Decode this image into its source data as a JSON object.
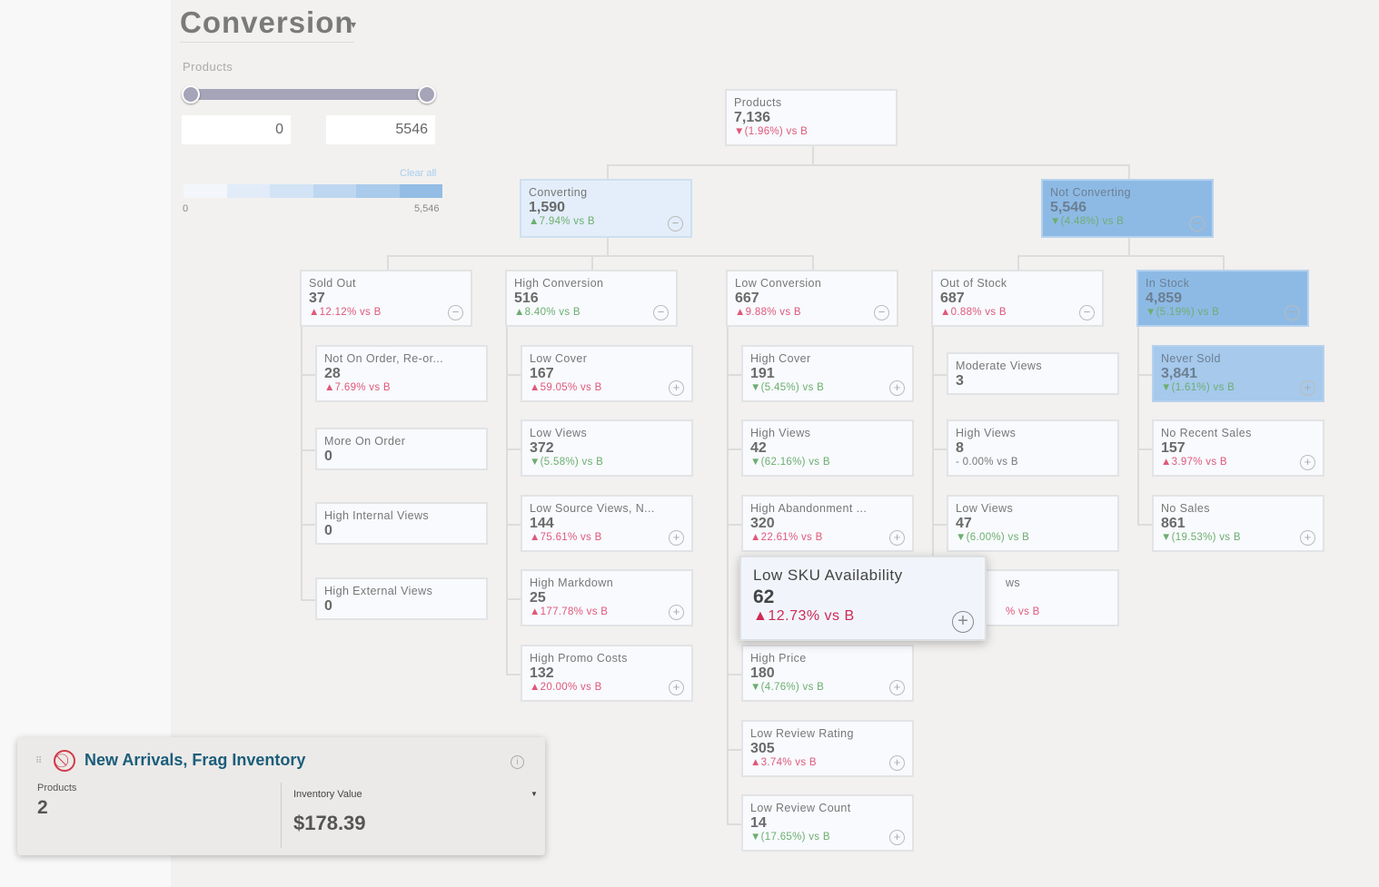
{
  "header": {
    "title": "Conversion",
    "caret": "▾"
  },
  "filter": {
    "label": "Products",
    "min_value": "0",
    "max_value": "5546",
    "clear_all": "Clear all",
    "legend_min": "0",
    "legend_max": "5,546",
    "legend_colors": [
      "#f3f6fa",
      "#e1ecf8",
      "#d2e3f5",
      "#bed7f0",
      "#aacbeb",
      "#93bde4"
    ]
  },
  "colors": {
    "up": "#e0587a",
    "down": "#6dae70",
    "light_blue": "#e3eefa",
    "blue": "#8dbae5",
    "never_sold": "#a6c9ec"
  },
  "tree": [
    {
      "title": "Products",
      "value": "7,136",
      "delta": "▼(1.96%) vs B",
      "tone": "up",
      "icon": "none",
      "fill": "white"
    },
    {
      "title": "Converting",
      "value": "1,590",
      "delta": "▲7.94% vs B",
      "tone": "down",
      "icon": "minus",
      "fill": "light_blue"
    },
    {
      "title": "Not Converting",
      "value": "5,546",
      "delta": "▼(4.48%) vs B",
      "tone": "down",
      "icon": "minus",
      "fill": "blue"
    },
    {
      "title": "Sold Out",
      "value": "37",
      "delta": "▲12.12% vs B",
      "tone": "up",
      "icon": "minus",
      "fill": "white"
    },
    {
      "title": "High Conversion",
      "value": "516",
      "delta": "▲8.40% vs B",
      "tone": "down",
      "icon": "minus",
      "fill": "white"
    },
    {
      "title": "Low Conversion",
      "value": "667",
      "delta": "▲9.88% vs B",
      "tone": "up",
      "icon": "minus",
      "fill": "white"
    },
    {
      "title": "Out of Stock",
      "value": "687",
      "delta": "▲0.88% vs B",
      "tone": "up",
      "icon": "minus",
      "fill": "white"
    },
    {
      "title": "In Stock",
      "value": "4,859",
      "delta": "▼(5.19%) vs B",
      "tone": "down",
      "icon": "minus",
      "fill": "blue"
    },
    {
      "title": "Not On Order, Re-or...",
      "value": "28",
      "delta": "▲7.69% vs B",
      "tone": "up",
      "icon": "none",
      "fill": "white"
    },
    {
      "title": "More On Order",
      "value": "0",
      "delta": "",
      "tone": "flat",
      "icon": "none",
      "fill": "white"
    },
    {
      "title": "High Internal Views",
      "value": "0",
      "delta": "",
      "tone": "flat",
      "icon": "none",
      "fill": "white"
    },
    {
      "title": "High External Views",
      "value": "0",
      "delta": "",
      "tone": "flat",
      "icon": "none",
      "fill": "white"
    },
    {
      "title": "Low Cover",
      "value": "167",
      "delta": "▲59.05% vs B",
      "tone": "up",
      "icon": "plus",
      "fill": "white"
    },
    {
      "title": "Low Views",
      "value": "372",
      "delta": "▼(5.58%) vs B",
      "tone": "down",
      "icon": "none",
      "fill": "white"
    },
    {
      "title": "Low Source Views, N...",
      "value": "144",
      "delta": "▲75.61% vs B",
      "tone": "up",
      "icon": "plus",
      "fill": "white"
    },
    {
      "title": "High Markdown",
      "value": "25",
      "delta": "▲177.78% vs B",
      "tone": "up",
      "icon": "plus",
      "fill": "white"
    },
    {
      "title": "High Promo Costs",
      "value": "132",
      "delta": "▲20.00% vs B",
      "tone": "up",
      "icon": "plus",
      "fill": "white"
    },
    {
      "title": "High Cover",
      "value": "191",
      "delta": "▼(5.45%) vs B",
      "tone": "down",
      "icon": "plus",
      "fill": "white"
    },
    {
      "title": "High Views",
      "value": "42",
      "delta": "▼(62.16%) vs B",
      "tone": "down",
      "icon": "none",
      "fill": "white"
    },
    {
      "title": "High Abandonment ...",
      "value": "320",
      "delta": "▲22.61% vs B",
      "tone": "up",
      "icon": "plus",
      "fill": "white"
    },
    {
      "title": "High Price",
      "value": "180",
      "delta": "▼(4.76%) vs B",
      "tone": "down",
      "icon": "plus",
      "fill": "white"
    },
    {
      "title": "Low Review Rating",
      "value": "305",
      "delta": "▲3.74% vs B",
      "tone": "up",
      "icon": "plus",
      "fill": "white"
    },
    {
      "title": "Low Review Count",
      "value": "14",
      "delta": "▼(17.65%) vs B",
      "tone": "down",
      "icon": "plus",
      "fill": "white"
    },
    {
      "title": "Moderate Views",
      "value": "3",
      "delta": "",
      "tone": "flat",
      "icon": "none",
      "fill": "white"
    },
    {
      "title": "High Views",
      "value": "8",
      "delta": "- 0.00% vs B",
      "tone": "flat",
      "icon": "none",
      "fill": "white"
    },
    {
      "title": "Low Views",
      "value": "47",
      "delta": "▼(6.00%) vs B",
      "tone": "down",
      "icon": "none",
      "fill": "white"
    },
    {
      "title": "ws",
      "value": "",
      "delta": "% vs B",
      "tone": "up",
      "icon": "none",
      "fill": "white"
    },
    {
      "title": "Never Sold",
      "value": "3,841",
      "delta": "▼(1.61%) vs B",
      "tone": "down",
      "icon": "plus",
      "fill": "never_sold"
    },
    {
      "title": "No Recent Sales",
      "value": "157",
      "delta": "▲3.97% vs B",
      "tone": "up",
      "icon": "plus",
      "fill": "white"
    },
    {
      "title": "No Sales",
      "value": "861",
      "delta": "▼(19.53%) vs B",
      "tone": "down",
      "icon": "plus",
      "fill": "white"
    }
  ],
  "popup": {
    "title": "Low SKU Availability",
    "value": "62",
    "delta": "▲12.73% vs B",
    "icon": "plus"
  },
  "segment_card": {
    "title": "New Arrivals, Frag Inventory",
    "products_label": "Products",
    "products_value": "2",
    "metric_label": "Inventory Value",
    "metric_value": "$178.39"
  }
}
